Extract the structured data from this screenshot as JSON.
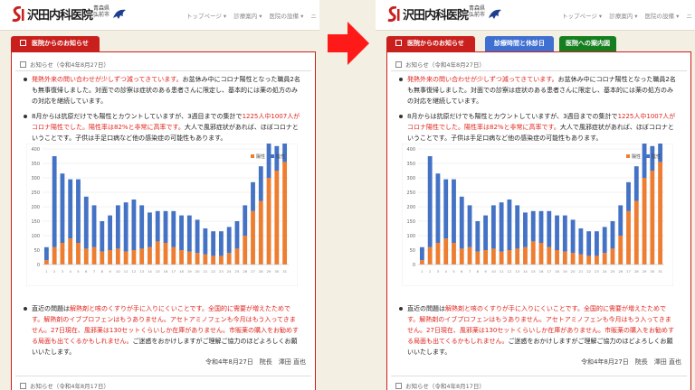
{
  "site": {
    "logo_text": "沢田内科医院",
    "logo_sub1": "青森県",
    "logo_sub2": "弘前市"
  },
  "nav": [
    "トップページ ▾",
    "診療案内 ▾",
    "医院の設備 ▾",
    "ニ"
  ],
  "tabs": {
    "news": "医院からのお知らせ",
    "hours": "診療時間と休診日",
    "guide": "医院への案内図"
  },
  "post": {
    "date": "お知らせ（令和4年8月27日）",
    "b1_red": "発熱外来の問い合わせが少しずつ減ってきています。",
    "b1_rest": "お盆休み中にコロナ陽性となった職員2名も無事復帰しました。対面での診察は症状のある患者さんに限定し、基本的には薬の処方のみの対応を継続しています。",
    "b2_a": "8月からは抗原だけでも陽性とカウントしていますが、3週目までの集計で",
    "b2_red1": "1225人中1007人がコロナ陽性でした。",
    "b2_red2": "陽性率は82%と非常に高率です。",
    "b2_b": "大人で風邪症状があれば、ほぼコロナということです。子供は手足口病など他の感染症の可能性もあります。",
    "b3_a": "直近の問題は",
    "b3_red1": "解熱剤と咳のくすりが手に入りにくいことです。全国的に需要が増えたためです。解熱剤のイブプロフェンはもうありません。アセトアミノフェンも今月はもう入ってきません。27日現在、風邪薬は130セットくらいしか在庫がありません。市販薬の購入をお勧めする局面も出てくるかもしれません。",
    "b3_b": "ご迷惑をおかけしますがご理解ご協力のほどよろしくお願いいたします。",
    "sig": "令和4年8月27日　院長　澤田 直也",
    "next_date": "お知らせ（令和4年8月17日）"
  },
  "chart_data": {
    "type": "bar",
    "stacked": true,
    "ylim": [
      0,
      400
    ],
    "yticks": [
      0,
      50,
      100,
      150,
      200,
      250,
      300,
      350,
      400
    ],
    "categories": [
      "1",
      "2",
      "3",
      "4",
      "5",
      "6",
      "7",
      "8",
      "9",
      "10",
      "11",
      "12",
      "13",
      "14",
      "15",
      "16",
      "17",
      "18",
      "19",
      "20",
      "21",
      "22",
      "23",
      "24",
      "25",
      "26",
      "27",
      "28",
      "29",
      "30",
      "31"
    ],
    "series": [
      {
        "name": "陽性",
        "color": "#ed7d31",
        "values": [
          15,
          60,
          75,
          90,
          75,
          55,
          60,
          45,
          50,
          55,
          45,
          50,
          55,
          60,
          80,
          75,
          60,
          50,
          45,
          40,
          35,
          30,
          30,
          40,
          55,
          100,
          185,
          220,
          300,
          325,
          355
        ]
      },
      {
        "name": "陰性",
        "color": "#4472c4",
        "values": [
          45,
          315,
          240,
          205,
          220,
          180,
          145,
          105,
          120,
          150,
          170,
          175,
          150,
          120,
          105,
          110,
          125,
          120,
          125,
          115,
          90,
          85,
          85,
          90,
          95,
          105,
          100,
          120,
          135,
          85,
          75
        ]
      }
    ],
    "legend": "top-right",
    "grid": true
  }
}
